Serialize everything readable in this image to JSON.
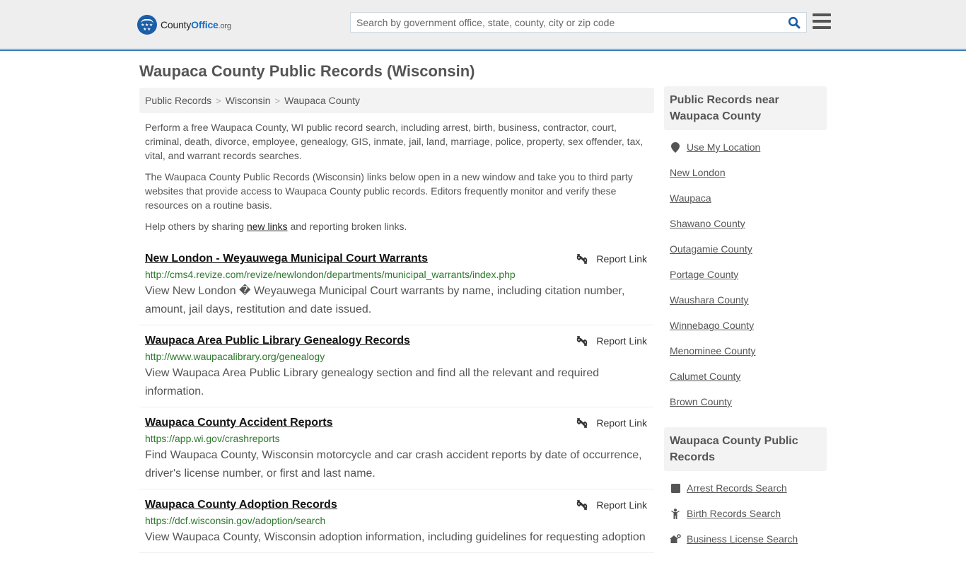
{
  "header": {
    "logo": {
      "brand_a": "County",
      "brand_b": "Office",
      "brand_c": ".org",
      "stars": "★★★ ★★",
      "accent": "#1b6ec2"
    },
    "search": {
      "placeholder": "Search by government office, state, county, city or zip code",
      "value": ""
    },
    "search_icon": "search-icon",
    "menu_icon": "hamburger-menu-icon"
  },
  "page": {
    "title": "Waupaca County Public Records (Wisconsin)"
  },
  "breadcrumb": {
    "items": [
      "Public Records",
      "Wisconsin",
      "Waupaca County"
    ],
    "separator": ">"
  },
  "intro": {
    "p1": "Perform a free Waupaca County, WI public record search, including arrest, birth, business, contractor, court, criminal, death, divorce, employee, genealogy, GIS, inmate, jail, land, marriage, police, property, sex offender, tax, vital, and warrant records searches.",
    "p2": "The Waupaca County Public Records (Wisconsin) links below open in a new window and take you to third party websites that provide access to Waupaca County public records. Editors frequently monitor and verify these resources on a routine basis.",
    "p3_before": "Help others by sharing ",
    "p3_link": "new links",
    "p3_after": " and reporting broken links."
  },
  "records": [
    {
      "title": "New London - Weyauwega Municipal Court Warrants",
      "url": "http://cms4.revize.com/revize/newlondon/departments/municipal_warrants/index.php",
      "description": "View New London � Weyauwega Municipal Court warrants by name, including citation number, amount, jail days, restitution and date issued.",
      "report_label": "Report Link"
    },
    {
      "title": "Waupaca Area Public Library Genealogy Records",
      "url": "http://www.waupacalibrary.org/genealogy",
      "description": "View Waupaca Area Public Library genealogy section and find all the relevant and required information.",
      "report_label": "Report Link"
    },
    {
      "title": "Waupaca County Accident Reports",
      "url": "https://app.wi.gov/crashreports",
      "description": "Find Waupaca County, Wisconsin motorcycle and car crash accident reports by date of occurrence, driver's license number, or first and last name.",
      "report_label": "Report Link"
    },
    {
      "title": "Waupaca County Adoption Records",
      "url": "https://dcf.wisconsin.gov/adoption/search",
      "description": "View Waupaca County, Wisconsin adoption information, including guidelines for requesting adoption",
      "report_label": "Report Link"
    }
  ],
  "sidebar": {
    "nearby": {
      "heading": "Public Records near Waupaca County",
      "use_location": "Use My Location",
      "links": [
        "New London",
        "Waupaca",
        "Shawano County",
        "Outagamie County",
        "Portage County",
        "Waushara County",
        "Winnebago County",
        "Menominee County",
        "Calumet County",
        "Brown County"
      ]
    },
    "county_records": {
      "heading": "Waupaca County Public Records",
      "links": [
        {
          "label": "Arrest Records Search",
          "icon": "arrest-icon"
        },
        {
          "label": "Birth Records Search",
          "icon": "baby-icon"
        },
        {
          "label": "Business License Search",
          "icon": "business-icon"
        }
      ]
    }
  },
  "colors": {
    "header_bg": "#eeeeee",
    "header_border": "#3a7cb0",
    "url_green": "#2d7a2d",
    "search_icon": "#1b5fa8"
  }
}
